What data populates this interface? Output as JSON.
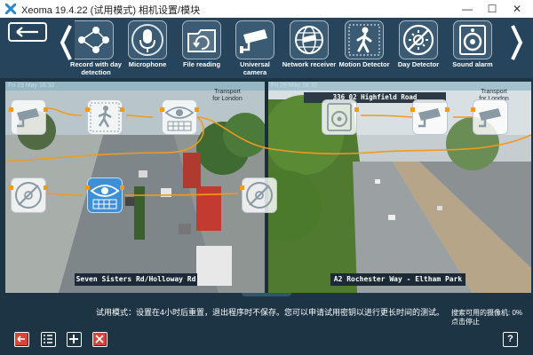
{
  "window": {
    "title": "Xeoma 19.4.22 (试用模式) 相机设置/模块",
    "minimize_symbol": "—",
    "maximize_symbol": "☐",
    "close_symbol": "✕"
  },
  "toolbar": {
    "back_icon": "back-arrow-icon",
    "modules": [
      {
        "label": "Record with day\ndetection",
        "icon": "network-graph-icon"
      },
      {
        "label": "Microphone",
        "icon": "microphone-icon"
      },
      {
        "label": "File reading",
        "icon": "folder-refresh-icon"
      },
      {
        "label": "Universal\ncamera",
        "icon": "camera-icon"
      },
      {
        "label": "Network receiver",
        "icon": "globe-camera-icon"
      },
      {
        "label": "Motion Detector",
        "icon": "walking-person-icon"
      },
      {
        "label": "Day Detector",
        "icon": "sun-crossed-icon"
      },
      {
        "label": "Sound alarm",
        "icon": "speaker-icon"
      }
    ]
  },
  "cameras": [
    {
      "timestamp": "Fri 29 May 16:32",
      "brand": "Transport\nfor London",
      "caption": "Seven Sisters Rd/Holloway Rd"
    },
    {
      "timestamp": "Fri 29 May 16:32",
      "road_sign": "336 02 Highfield Road",
      "brand": "Transport\nfor London",
      "caption": "A2 Rochester Way - Eltham Park"
    }
  ],
  "status": {
    "trial_message": "试用模式：设置在4小时后重置，退出程序时不保存。您可以申请试用密钥以进行更长时间的测试。",
    "search_line1": "搜索可用的摄像机: 0%",
    "search_line2": "点击停止"
  },
  "bottom_toolbar": {
    "buttons": [
      "exit-icon",
      "list-icon",
      "add-icon",
      "delete-icon"
    ],
    "help_label": "?"
  },
  "colors": {
    "accent_orange": "#f19a1e",
    "panel_dark": "#1d3445",
    "toolbar_bg": "#26455c",
    "bottom_button_red": "#d9433a",
    "selected_module": "#3f8fd6"
  }
}
